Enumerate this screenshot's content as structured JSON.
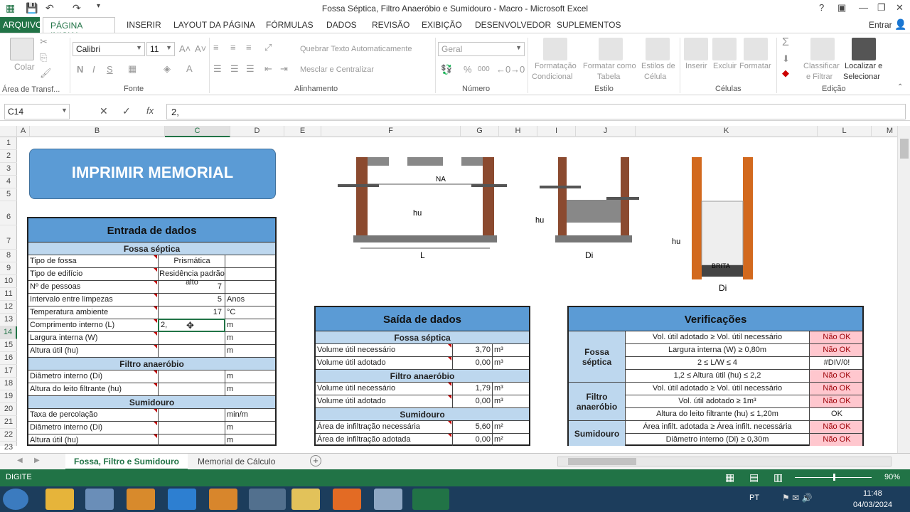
{
  "window": {
    "title": "Fossa Séptica, Filtro Anaeróbio e Sumidouro - Macro - Microsoft Excel",
    "help": "?",
    "user": "Entrar"
  },
  "tabs": {
    "arquivo": "ARQUIVO",
    "home": "PÁGINA INICIAL",
    "items": [
      "INSERIR",
      "LAYOUT DA PÁGINA",
      "FÓRMULAS",
      "DADOS",
      "REVISÃO",
      "EXIBIÇÃO",
      "DESENVOLVEDOR",
      "SUPLEMENTOS"
    ]
  },
  "ribbon": {
    "clipboard": {
      "paste": "Colar",
      "label": "Área de Transf..."
    },
    "font": {
      "name": "Calibri",
      "size": "11",
      "bold": "N",
      "italic": "I",
      "underline": "S",
      "label": "Fonte"
    },
    "align": {
      "wrap": "Quebrar Texto Automaticamente",
      "merge": "Mesclar e Centralizar",
      "label": "Alinhamento"
    },
    "number": {
      "format": "Geral",
      "percent": "%",
      "thousands": "000",
      "label": "Número"
    },
    "styles": {
      "cond": "Formatação",
      "cond2": "Condicional",
      "table": "Formatar como",
      "table2": "Tabela",
      "cell": "Estilos de",
      "cell2": "Célula",
      "label": "Estilo"
    },
    "cells": {
      "insert": "Inserir",
      "delete": "Excluir",
      "format": "Formatar",
      "label": "Células"
    },
    "edit": {
      "sort": "Classificar",
      "sort2": "e Filtrar",
      "find": "Localizar e",
      "find2": "Selecionar",
      "label": "Edição"
    }
  },
  "formula": {
    "namebox": "C14",
    "value": "2,",
    "fx": "fx"
  },
  "columns": [
    "A",
    "B",
    "C",
    "D",
    "E",
    "F",
    "G",
    "H",
    "I",
    "J",
    "K",
    "L",
    "M"
  ],
  "rows": [
    "1",
    "2",
    "3",
    "4",
    "5",
    "6",
    "7",
    "8",
    "9",
    "10",
    "11",
    "12",
    "13",
    "14",
    "15",
    "16",
    "17",
    "18",
    "19",
    "20",
    "21",
    "22",
    "23"
  ],
  "print_button": "IMPRIMIR MEMORIAL",
  "input": {
    "title": "Entrada de dados",
    "s_fossa": "Fossa séptica",
    "s_filtro": "Filtro anaeróbio",
    "s_sumidouro": "Sumidouro",
    "rows": [
      {
        "label": "Tipo de fossa",
        "value": "Prismática",
        "unit": ""
      },
      {
        "label": "Tipo de edifício",
        "value": "Residência padrão alto",
        "unit": ""
      },
      {
        "label": "Nº de pessoas",
        "value": "7",
        "unit": ""
      },
      {
        "label": "Intervalo entre limpezas",
        "value": "5",
        "unit": "Anos"
      },
      {
        "label": "Temperatura ambiente",
        "value": "17",
        "unit": "°C"
      },
      {
        "label": "Comprimento interno (L)",
        "value": "2,",
        "unit": "m"
      },
      {
        "label": "Largura interna (W)",
        "value": "",
        "unit": "m"
      },
      {
        "label": "Altura útil (hu)",
        "value": "",
        "unit": "m"
      },
      {
        "label": "Diâmetro interno (Di)",
        "value": "",
        "unit": "m"
      },
      {
        "label": "Altura do leito filtrante (hu)",
        "value": "",
        "unit": "m"
      },
      {
        "label": "Taxa de percolação",
        "value": "",
        "unit": "min/m"
      },
      {
        "label": "Diâmetro interno (Di)",
        "value": "",
        "unit": "m"
      },
      {
        "label": "Altura útil (hu)",
        "value": "",
        "unit": "m"
      }
    ]
  },
  "output": {
    "title": "Saída de dados",
    "s_fossa": "Fossa séptica",
    "s_filtro": "Filtro anaeróbio",
    "s_sumidouro": "Sumidouro",
    "rows": [
      {
        "label": "Volume útil necessário",
        "value": "3,70",
        "unit": "m³"
      },
      {
        "label": "Volume útil adotado",
        "value": "0,00",
        "unit": "m³"
      },
      {
        "label": "Volume útil necessário",
        "value": "1,79",
        "unit": "m³"
      },
      {
        "label": "Volume útil adotado",
        "value": "0,00",
        "unit": "m³"
      },
      {
        "label": "Área de infiltração necessária",
        "value": "5,60",
        "unit": "m²"
      },
      {
        "label": "Área de infiltração adotada",
        "value": "0,00",
        "unit": "m²"
      }
    ]
  },
  "checks": {
    "title": "Verificações",
    "g_fossa": "Fossa séptica",
    "g_filtro": "Filtro anaeróbio",
    "g_sumidouro": "Sumidouro",
    "rows": [
      {
        "label": "Vol. útil adotado ≥ Vol. útil necessário",
        "result": "Não OK"
      },
      {
        "label": "Largura interna (W) ≥ 0,80m",
        "result": "Não OK"
      },
      {
        "label": "2 ≤ L/W ≤ 4",
        "result": "#DIV/0!"
      },
      {
        "label": "1,2 ≤ Altura útil (hu) ≤ 2,2",
        "result": "Não OK"
      },
      {
        "label": "Vol. útil adotado ≥ Vol. útil necessário",
        "result": "Não OK"
      },
      {
        "label": "Vol. útil adotado ≥ 1m³",
        "result": "Não OK"
      },
      {
        "label": "Altura do leito filtrante (hu) ≤ 1,20m",
        "result": "OK"
      },
      {
        "label": "Área infilt. adotada ≥ Área infilt. necessária",
        "result": "Não OK"
      },
      {
        "label": "Diâmetro interno (Di) ≥ 0,30m",
        "result": "Não OK"
      }
    ]
  },
  "drawings": {
    "na": "NA",
    "hu": "hu",
    "l": "L",
    "di": "Di",
    "brita": "BRITA"
  },
  "sheet_tabs": {
    "active": "Fossa, Filtro e Sumidouro",
    "second": "Memorial de Cálculo",
    "add": "+"
  },
  "status": {
    "mode": "DIGITE",
    "zoom": "90%"
  },
  "taskbar": {
    "lang": "PT",
    "time": "11:48",
    "date": "04/03/2024"
  },
  "colors": {
    "excel_green": "#217346",
    "header_blue": "#5b9bd5",
    "sub_blue": "#bdd7ee",
    "nok_bg": "#ffc7ce",
    "nok_fg": "#9c0006"
  }
}
